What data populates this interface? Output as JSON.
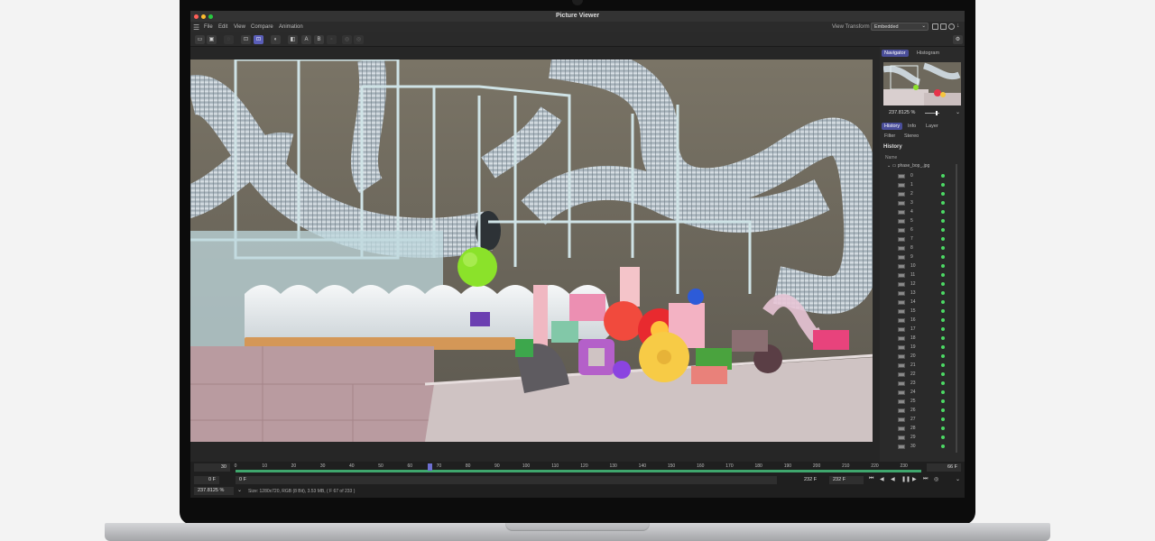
{
  "window": {
    "title": "Picture Viewer"
  },
  "menu": {
    "items": [
      "File",
      "Edit",
      "View",
      "Compare",
      "Animation"
    ],
    "view_transform_label": "View Transform",
    "view_transform_value": "Embedded"
  },
  "toolbar": {
    "buttons": [
      "open-folder-icon",
      "save-icon",
      "circle-icon",
      "zoom-fit-icon",
      "zoom-region-icon",
      "contrast-icon",
      "channel-icon",
      "A",
      "B",
      "compare-icon",
      "swap-icon",
      "settings-icon"
    ]
  },
  "panel": {
    "tabs_top": [
      "Navigator",
      "Histogram"
    ],
    "zoom_value": "237.8125 %",
    "tabs_mid": [
      "History",
      "Info",
      "Layer"
    ],
    "tabs_sub": [
      "Filter",
      "Stereo"
    ],
    "history_title": "History",
    "column_name": "Name",
    "folder_name": "phase_bop_.jpg",
    "history_rows": [
      "0",
      "1",
      "2",
      "3",
      "4",
      "5",
      "6",
      "7",
      "8",
      "9",
      "10",
      "11",
      "12",
      "13",
      "14",
      "15",
      "16",
      "17",
      "18",
      "19",
      "20",
      "21",
      "22",
      "23",
      "24",
      "25",
      "26",
      "27",
      "28",
      "29",
      "30"
    ]
  },
  "timeline": {
    "fps": "30",
    "ticks": [
      "0",
      "10",
      "20",
      "30",
      "40",
      "50",
      "60",
      "70",
      "80",
      "90",
      "100",
      "110",
      "120",
      "130",
      "140",
      "150",
      "160",
      "170",
      "180",
      "190",
      "200",
      "210",
      "220",
      "230"
    ],
    "end_frame": "66 F",
    "start_frame_left": "0 F",
    "start_frame": "0 F",
    "frame_a": "232 F",
    "frame_b": "232 F"
  },
  "status": {
    "zoom": "237.8125 %",
    "info": "Size: 1280x720, RGB (8 Bit), 3.53 MB,  ( F 67 of 233 )"
  }
}
